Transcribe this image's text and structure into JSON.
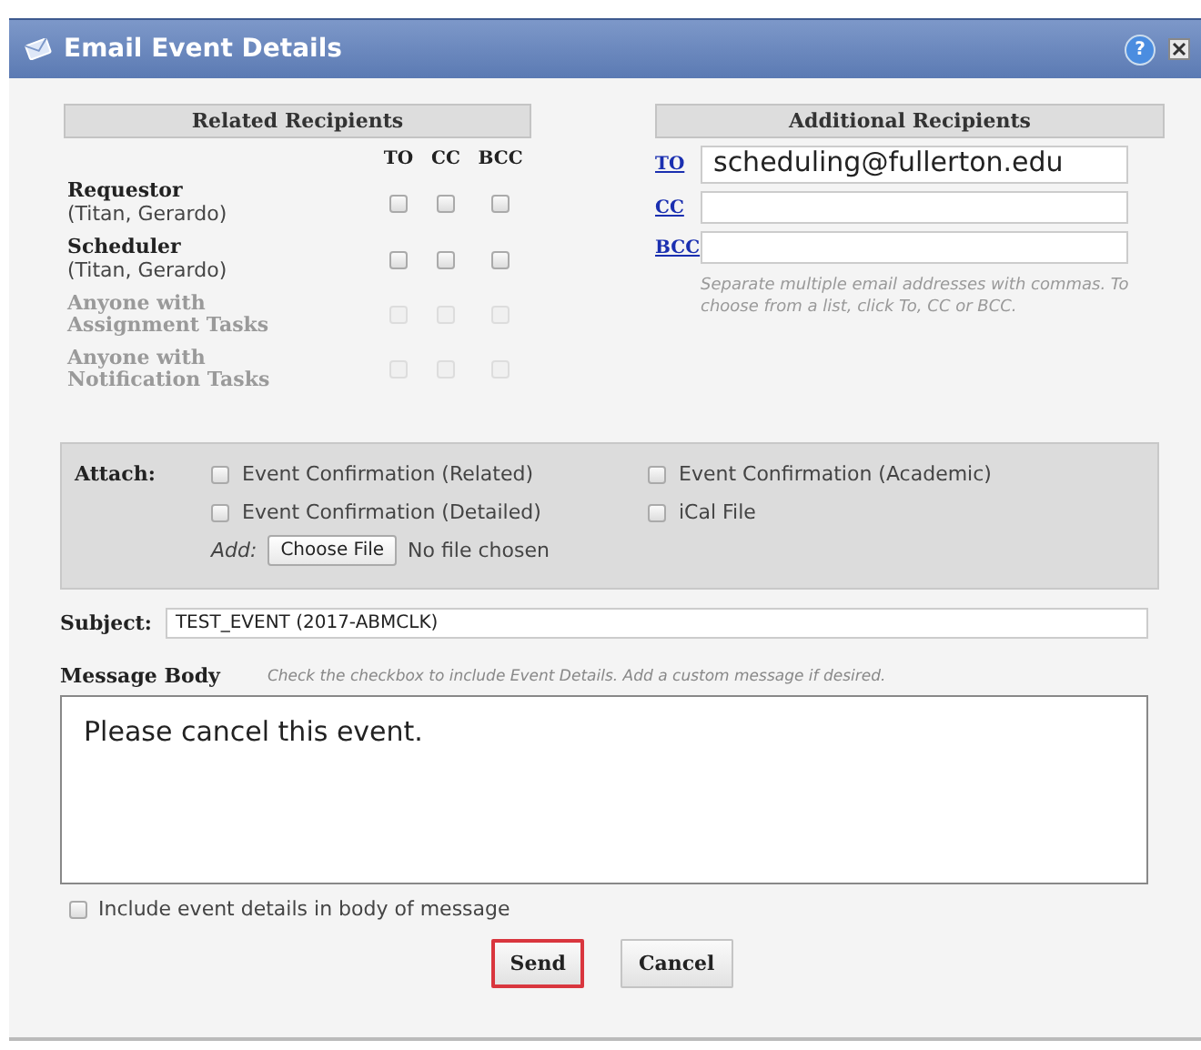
{
  "window": {
    "title": "Email Event Details",
    "help": "?"
  },
  "related_recipients": {
    "heading": "Related Recipients",
    "columns": [
      "TO",
      "CC",
      "BCC"
    ],
    "rows": [
      {
        "role": "Requestor",
        "name": "(Titan, Gerardo)",
        "disabled": false,
        "to": false,
        "cc": false,
        "bcc": false
      },
      {
        "role": "Scheduler",
        "name": "(Titan, Gerardo)",
        "disabled": false,
        "to": false,
        "cc": false,
        "bcc": false
      },
      {
        "role": "Anyone with Assignment Tasks",
        "disabled": true,
        "to": false,
        "cc": false,
        "bcc": false
      },
      {
        "role": "Anyone with Notification Tasks",
        "disabled": true,
        "to": false,
        "cc": false,
        "bcc": false
      }
    ]
  },
  "additional_recipients": {
    "heading": "Additional Recipients",
    "fields": [
      {
        "label": "TO",
        "value": "scheduling@fullerton.edu"
      },
      {
        "label": "CC"
      },
      {
        "label": "BCC"
      }
    ],
    "hint": "Separate multiple email addresses with commas. To choose from a list, click To, CC or BCC."
  },
  "attach": {
    "label": "Attach:",
    "options": [
      {
        "label": "Event Confirmation (Related)",
        "checked": false
      },
      {
        "label": "Event Confirmation (Academic)",
        "checked": false
      },
      {
        "label": "Event Confirmation (Detailed)",
        "checked": false
      },
      {
        "label": "iCal File",
        "checked": false
      }
    ],
    "add_label": "Add:",
    "file_button": "Choose File",
    "file_status": "No file chosen"
  },
  "subject": {
    "label": "Subject:",
    "value": "TEST_EVENT (2017-ABMCLK)"
  },
  "message": {
    "label": "Message Body",
    "hint": "Check the checkbox to include Event Details. Add a custom message if desired.",
    "value": "Please cancel this event.",
    "include_details": {
      "label": "Include event details in body of message",
      "checked": false
    }
  },
  "buttons": [
    {
      "label": "Send",
      "focused": true
    },
    {
      "label": "Cancel",
      "focused": false
    }
  ]
}
